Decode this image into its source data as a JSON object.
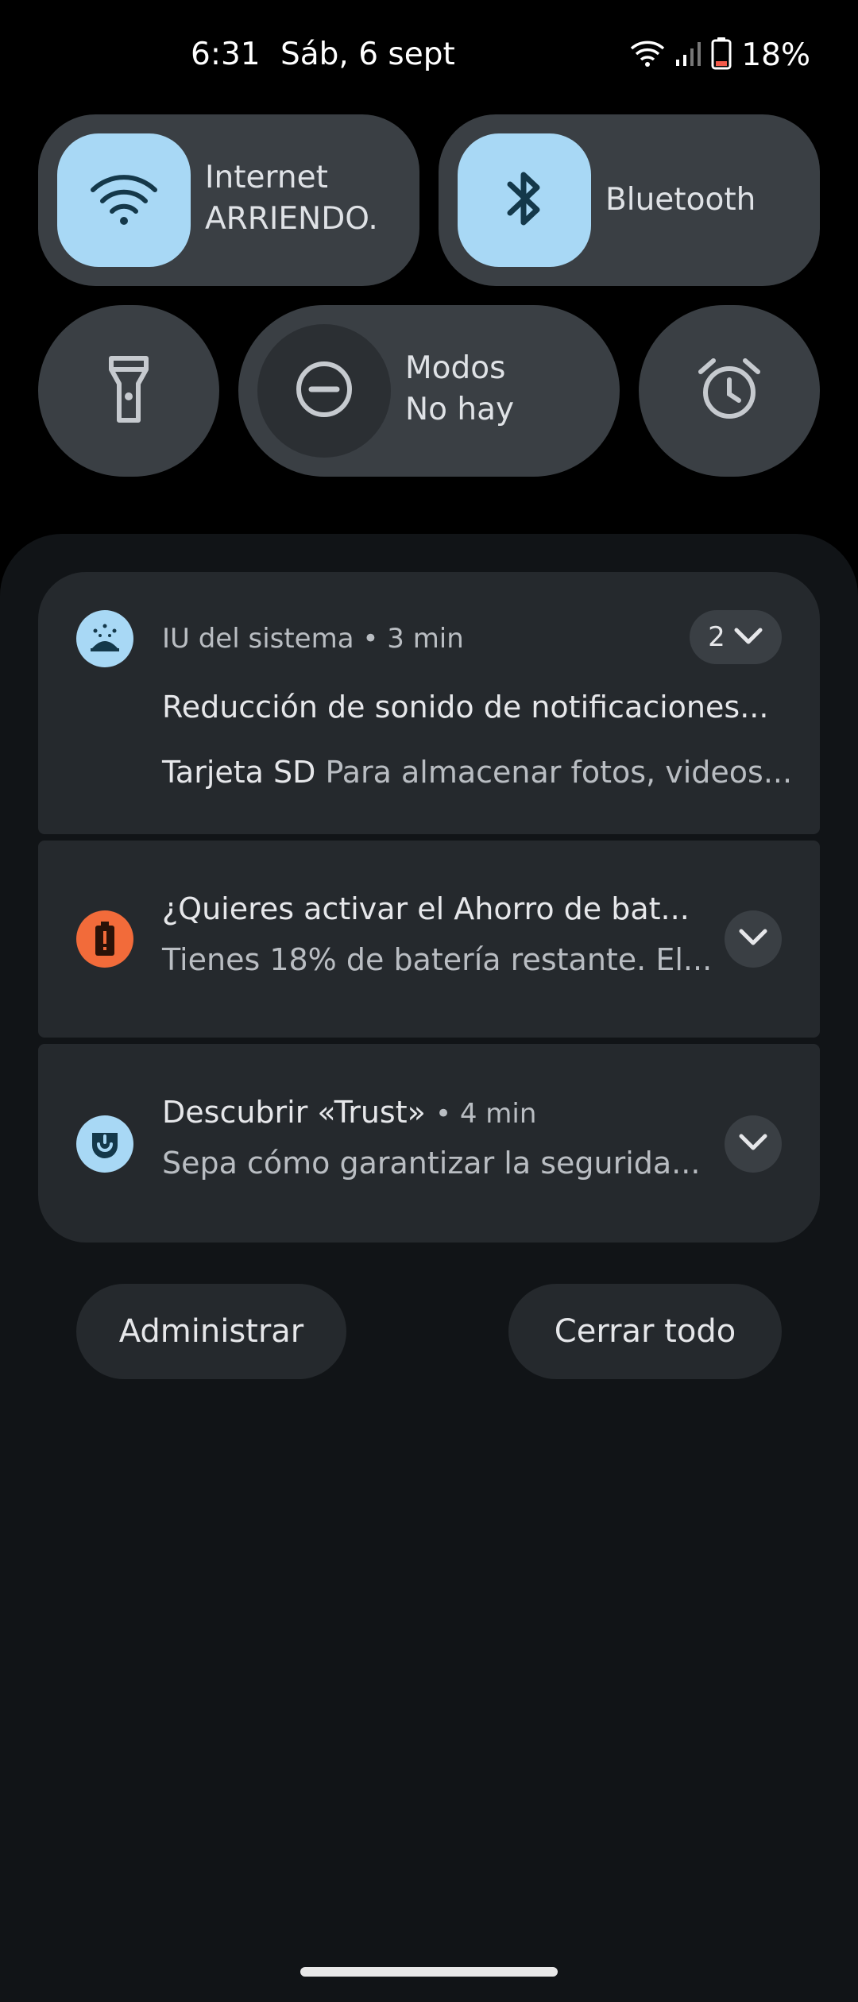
{
  "status_bar": {
    "time": "6:31",
    "date": "Sáb, 6 sept",
    "battery": "18%",
    "icons": [
      "wifi-icon",
      "cellular-signal-icon",
      "battery-low-icon"
    ]
  },
  "quick_settings": {
    "internet": {
      "label": "Internet",
      "sublabel": "ARRIENDO.",
      "icon": "wifi-icon"
    },
    "bluetooth": {
      "label": "Bluetooth",
      "icon": "bluetooth-icon"
    },
    "flashlight": {
      "icon": "flashlight-icon"
    },
    "modes": {
      "label": "Modos",
      "sublabel": "No hay",
      "icon": "do-not-disturb-icon"
    },
    "alarm": {
      "icon": "alarm-icon"
    }
  },
  "notifications": [
    {
      "app": "IU del sistema",
      "time": "3 min",
      "count": "2",
      "title": "Reducción de sonido de notificaciones...",
      "line2_bold": "Tarjeta SD",
      "line2": "Para almacenar fotos, videos..."
    },
    {
      "title": "¿Quieres activar el Ahorro de bat...",
      "text": "Tienes 18% de batería restante. El..."
    },
    {
      "title": "Descubrir «Trust»",
      "time": "4 min",
      "text": "Sepa cómo garantizar la segurida..."
    }
  ],
  "actions": {
    "manage": "Administrar",
    "clear_all": "Cerrar todo"
  },
  "colors": {
    "tile_bg": "#3a3f44",
    "tile_active": "#a8d8f5",
    "card_bg": "#25292d",
    "battery_warning": "#f26b3a"
  }
}
